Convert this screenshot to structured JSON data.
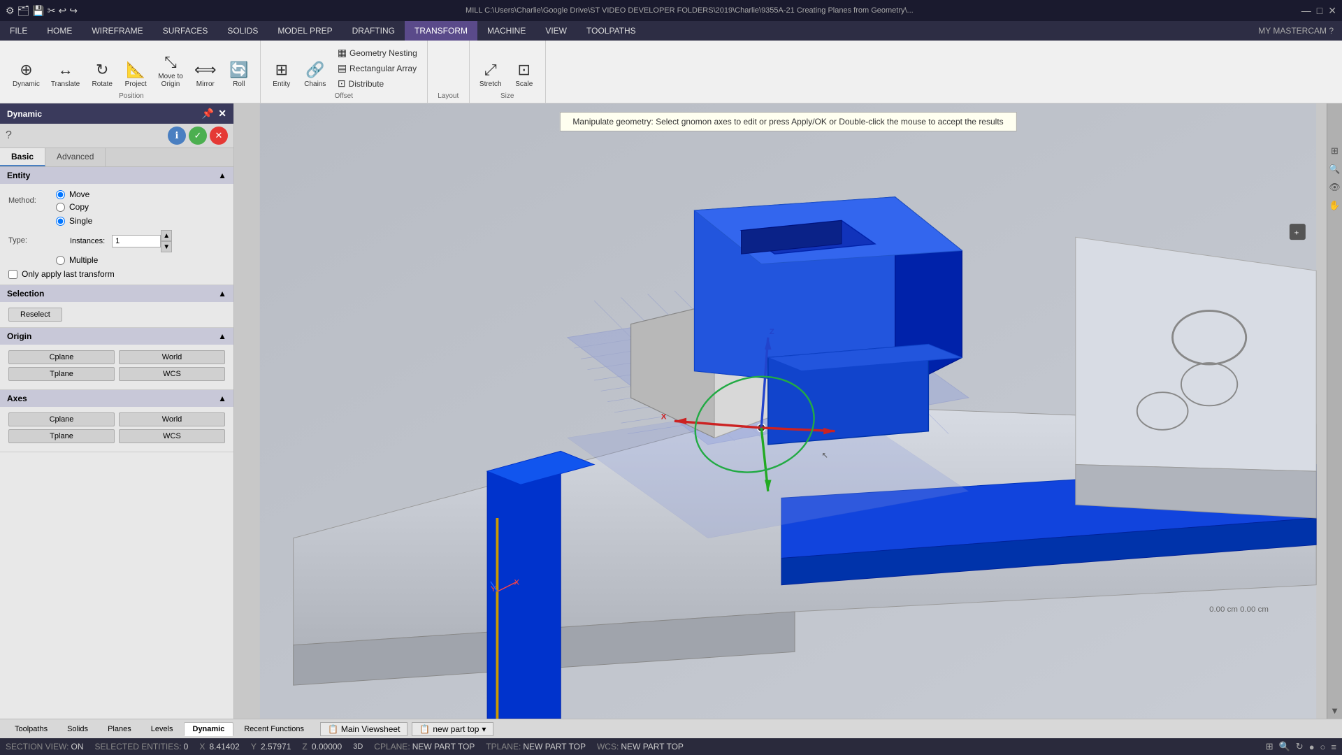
{
  "titleBar": {
    "icons": [
      "🗂",
      "💾",
      "✂",
      "📋",
      "↩",
      "↪",
      "⚙"
    ],
    "title": "MILL   C:\\Users\\Charlie\\Google Drive\\ST VIDEO DEVELOPER FOLDERS\\2019\\Charlie\\9355A-21 Creating Planes from Geometry\\...",
    "controls": [
      "—",
      "□",
      "✕"
    ]
  },
  "menuBar": {
    "items": [
      {
        "label": "FILE",
        "active": false
      },
      {
        "label": "HOME",
        "active": false
      },
      {
        "label": "WIREFRAME",
        "active": false
      },
      {
        "label": "SURFACES",
        "active": false
      },
      {
        "label": "SOLIDS",
        "active": false
      },
      {
        "label": "MODEL PREP",
        "active": false
      },
      {
        "label": "DRAFTING",
        "active": false
      },
      {
        "label": "TRANSFORM",
        "active": true
      },
      {
        "label": "MACHINE",
        "active": false
      },
      {
        "label": "VIEW",
        "active": false
      },
      {
        "label": "TOOLPATHS",
        "active": false
      }
    ],
    "right": "MY MASTERCAM  ?"
  },
  "ribbon": {
    "groups": [
      {
        "label": "Position",
        "buttons": [
          {
            "icon": "⊕",
            "label": "Dynamic"
          },
          {
            "icon": "↔",
            "label": "Translate"
          },
          {
            "icon": "↻",
            "label": "Rotate"
          },
          {
            "icon": "📐",
            "label": "Project"
          },
          {
            "icon": "⇔",
            "label": "Move to\nOrigin"
          },
          {
            "icon": "⟺",
            "label": "Mirror"
          },
          {
            "icon": "🔄",
            "label": "Roll"
          }
        ]
      },
      {
        "label": "Offset",
        "buttons": [
          {
            "icon": "⊞",
            "label": "Entity"
          },
          {
            "icon": "🔗",
            "label": "Chains"
          }
        ],
        "small": [
          {
            "icon": "▦",
            "label": "Geometry Nesting"
          },
          {
            "icon": "▤",
            "label": "Rectangular Array"
          },
          {
            "icon": "⊡",
            "label": "Distribute"
          }
        ]
      },
      {
        "label": "Layout",
        "buttons": []
      },
      {
        "label": "Size",
        "buttons": [
          {
            "icon": "⤢",
            "label": "Stretch"
          },
          {
            "icon": "⊡",
            "label": "Scale"
          }
        ]
      }
    ]
  },
  "panel": {
    "title": "Dynamic",
    "tabs": [
      {
        "label": "Basic",
        "active": true
      },
      {
        "label": "Advanced",
        "active": false
      }
    ],
    "sections": {
      "entity": {
        "title": "Entity",
        "method": {
          "label": "Method:",
          "options": [
            {
              "label": "Move",
              "selected": true
            },
            {
              "label": "Copy",
              "selected": false
            }
          ]
        },
        "type": {
          "label": "Type:",
          "options": [
            {
              "label": "Single",
              "selected": true
            },
            {
              "label": "Multiple",
              "selected": false
            }
          ]
        },
        "instances": {
          "label": "Instances:",
          "value": "1"
        },
        "checkbox": "Only apply last transform"
      },
      "selection": {
        "title": "Selection",
        "reselect": "Reselect"
      },
      "origin": {
        "title": "Origin",
        "buttons": [
          {
            "label": "Cplane",
            "active": false
          },
          {
            "label": "World",
            "active": false
          },
          {
            "label": "Tplane",
            "active": false
          },
          {
            "label": "WCS",
            "active": false
          }
        ]
      },
      "axes": {
        "title": "Axes",
        "buttons": [
          {
            "label": "Cplane",
            "active": false
          },
          {
            "label": "World",
            "active": false
          },
          {
            "label": "Tplane",
            "active": false
          },
          {
            "label": "WCS",
            "active": false
          }
        ]
      }
    }
  },
  "viewport": {
    "instruction": "Manipulate geometry: Select gnomon axes to edit or press Apply/OK or Double-click the mouse to accept the results"
  },
  "bottomTabs": [
    {
      "label": "Toolpaths",
      "active": false
    },
    {
      "label": "Solids",
      "active": false
    },
    {
      "label": "Planes",
      "active": false
    },
    {
      "label": "Levels",
      "active": false
    },
    {
      "label": "Dynamic",
      "active": true
    },
    {
      "label": "Recent Functions",
      "active": false
    }
  ],
  "viewSheet": {
    "main": "Main Viewsheet",
    "part": "new part top",
    "arrow": "▾"
  },
  "statusBar": {
    "sectionView": {
      "label": "SECTION VIEW:",
      "value": "ON"
    },
    "selectedEntities": {
      "label": "SELECTED ENTITIES:",
      "value": "0"
    },
    "x": {
      "label": "X",
      "value": "8.41402"
    },
    "y": {
      "label": "Y",
      "value": "2.57971"
    },
    "z": {
      "label": "Z",
      "value": "0.00000"
    },
    "mode": "3D",
    "cplane": {
      "label": "CPLANE:",
      "value": "NEW PART TOP"
    },
    "tplane": {
      "label": "TPLANE:",
      "value": "NEW PART TOP"
    },
    "wcs": {
      "label": "WCS:",
      "value": "NEW PART TOP"
    }
  }
}
